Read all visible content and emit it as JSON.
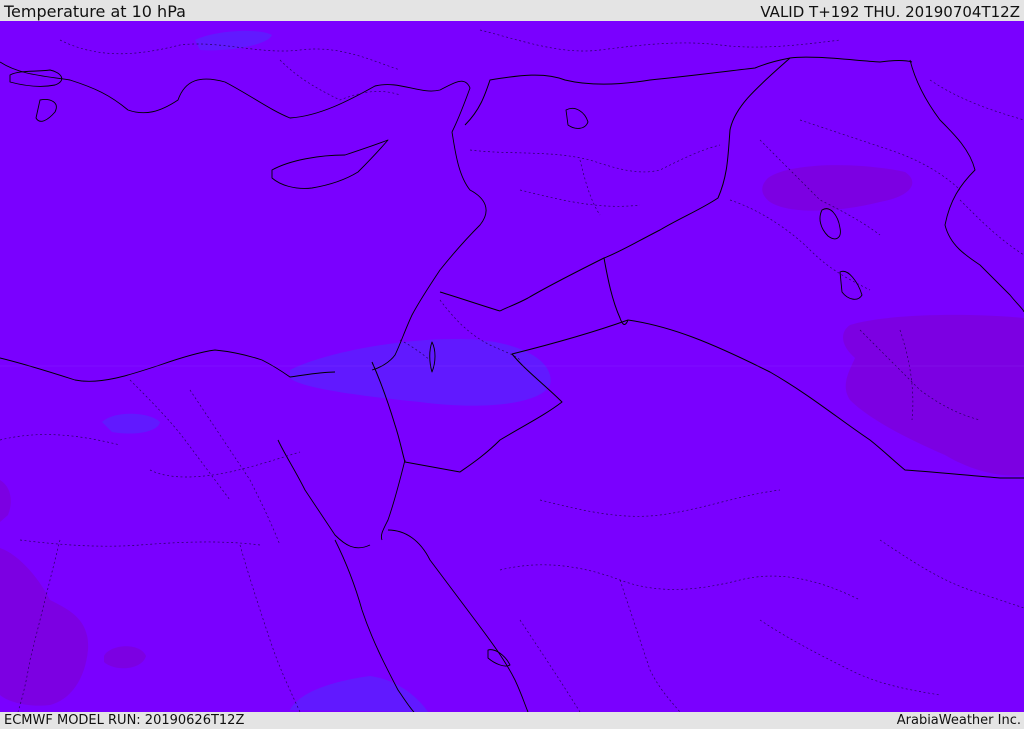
{
  "header": {
    "title": "Temperature at 10 hPa",
    "valid_time": "VALID T+192 THU. 20190704T12Z"
  },
  "footer": {
    "model_run": "ECMWF MODEL RUN: 20190626T12Z",
    "credit": "ArabiaWeather Inc."
  },
  "map": {
    "field": "Temperature at 10 hPa",
    "colors": {
      "base": "#7a00ff",
      "cooler_patch": "#5a22ff",
      "warmer_patch": "#7d00dd",
      "coastline": "#000000",
      "border": "#000000"
    }
  }
}
